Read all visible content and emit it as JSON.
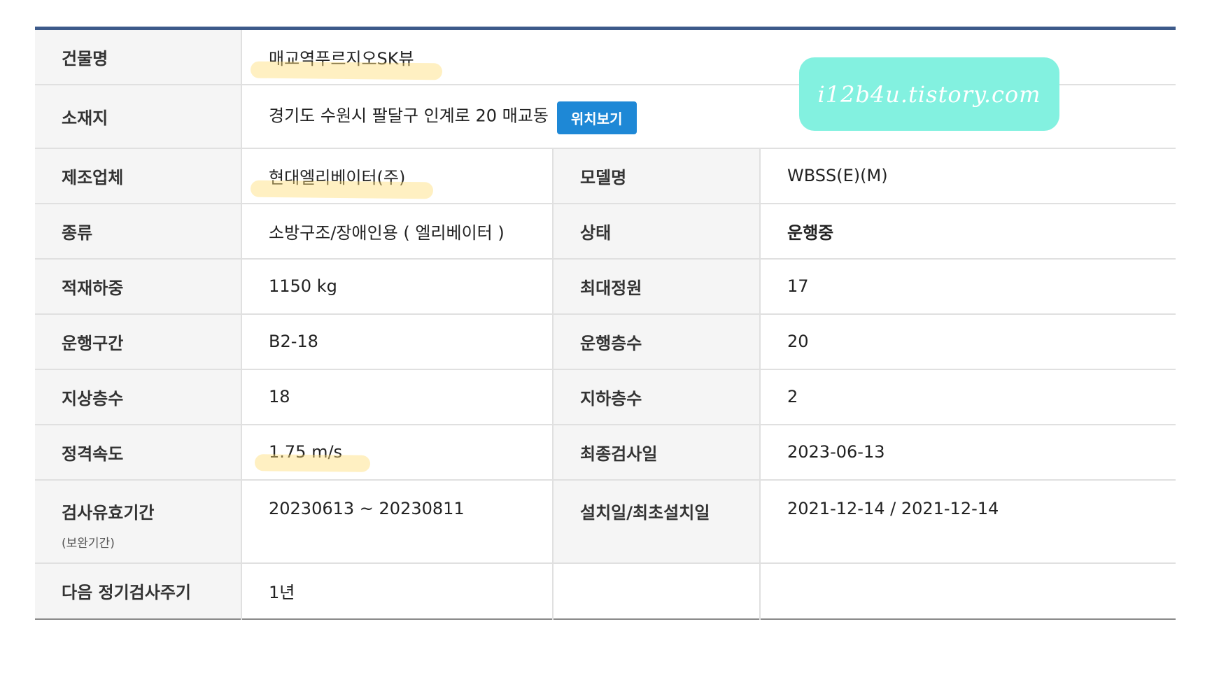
{
  "rows": [
    {
      "label": "건물명",
      "value": "매교역푸르지오SK뷰"
    },
    {
      "label": "소재지",
      "value": "경기도 수원시 팔달구 인계로 20 매교동",
      "button": "위치보기"
    },
    {
      "label": "제조업체",
      "value": "현대엘리베이터(주)",
      "label2": "모델명",
      "value2": "WBSS(E)(M)"
    },
    {
      "label": "종류",
      "value": "소방구조/장애인용 ( 엘리베이터 )",
      "label2": "상태",
      "value2": "운행중"
    },
    {
      "label": "적재하중",
      "value": "1150 kg",
      "label2": "최대정원",
      "value2": "17"
    },
    {
      "label": "운행구간",
      "value": "B2-18",
      "label2": "운행층수",
      "value2": "20"
    },
    {
      "label": "지상층수",
      "value": "18",
      "label2": "지하층수",
      "value2": "2"
    },
    {
      "label": "정격속도",
      "value": "1.75 m/s",
      "label2": "최종검사일",
      "value2": "2023-06-13"
    },
    {
      "label": "검사유효기간",
      "sublabel": "(보완기간)",
      "value": "20230613 ~ 20230811",
      "label2": "설치일/최초설치일",
      "value2": "2021-12-14 / 2021-12-14"
    },
    {
      "label": "다음 정기검사주기",
      "value": "1년"
    }
  ],
  "watermark": "i12b4u.tistory.com",
  "colors": {
    "header_border": "#3d5a8a",
    "button": "#1e88d6",
    "watermark_bg": "#83f1e0",
    "highlight": "#ffde78"
  }
}
